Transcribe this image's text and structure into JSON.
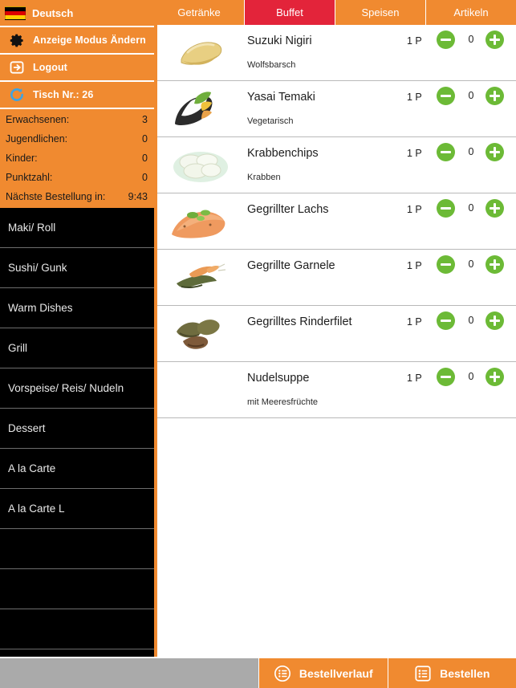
{
  "sidebar": {
    "language": {
      "label": "Deutsch",
      "icon": "german-flag-icon"
    },
    "actions": [
      {
        "label": "Anzeige Modus Ändern",
        "icon": "gear-icon"
      },
      {
        "label": "Logout",
        "icon": "logout-icon"
      },
      {
        "label": "Tisch Nr.: 26",
        "icon": "refresh-icon"
      }
    ],
    "stats": [
      {
        "label": "Erwachsenen:",
        "value": "3"
      },
      {
        "label": "Jugendlichen:",
        "value": "0"
      },
      {
        "label": "Kinder:",
        "value": "0"
      },
      {
        "label": "Punktzahl:",
        "value": "0"
      },
      {
        "label": "Nächste Bestellung in:",
        "value": "9:43"
      }
    ],
    "categories": [
      {
        "label": "Maki/ Roll"
      },
      {
        "label": "Sushi/ Gunk"
      },
      {
        "label": "Warm Dishes"
      },
      {
        "label": "Grill"
      },
      {
        "label": "Vorspeise/ Reis/ Nudeln"
      },
      {
        "label": "Dessert"
      },
      {
        "label": "A la Carte"
      },
      {
        "label": "A la Carte L"
      },
      {
        "label": ""
      },
      {
        "label": ""
      },
      {
        "label": ""
      }
    ]
  },
  "tabs": [
    {
      "label": "Getränke",
      "active": false
    },
    {
      "label": "Buffet",
      "active": true
    },
    {
      "label": "Speisen",
      "active": false
    },
    {
      "label": "Artikeln",
      "active": false
    }
  ],
  "items": [
    {
      "name": "Suzuki Nigiri",
      "subtitle": "Wolfsbarsch",
      "price": "1 P",
      "qty": "0",
      "thumb": "nigiri"
    },
    {
      "name": "Yasai Temaki",
      "subtitle": "Vegetarisch",
      "price": "1 P",
      "qty": "0",
      "thumb": "temaki"
    },
    {
      "name": "Krabbenchips",
      "subtitle": "Krabben",
      "price": "1 P",
      "qty": "0",
      "thumb": "chips"
    },
    {
      "name": "Gegrillter Lachs",
      "subtitle": "",
      "price": "1 P",
      "qty": "0",
      "thumb": "salmon"
    },
    {
      "name": "Gegrillte Garnele",
      "subtitle": "",
      "price": "1 P",
      "qty": "0",
      "thumb": "shrimp"
    },
    {
      "name": "Gegrilltes Rinderfilet",
      "subtitle": "",
      "price": "1 P",
      "qty": "0",
      "thumb": "beef"
    },
    {
      "name": "Nudelsuppe",
      "subtitle": "mit Meeresfrüchte",
      "price": "1 P",
      "qty": "0",
      "thumb": "none"
    }
  ],
  "bottom_bar": [
    {
      "label": "Bestellverlauf",
      "icon": "circle-list-icon"
    },
    {
      "label": "Bestellen",
      "icon": "square-list-icon"
    }
  ],
  "colors": {
    "orange": "#f08a30",
    "red_active_tab": "#e3243a",
    "green_button": "#6cba36",
    "sidebar_black": "#000000",
    "bottom_gray": "#aaaaaa"
  }
}
